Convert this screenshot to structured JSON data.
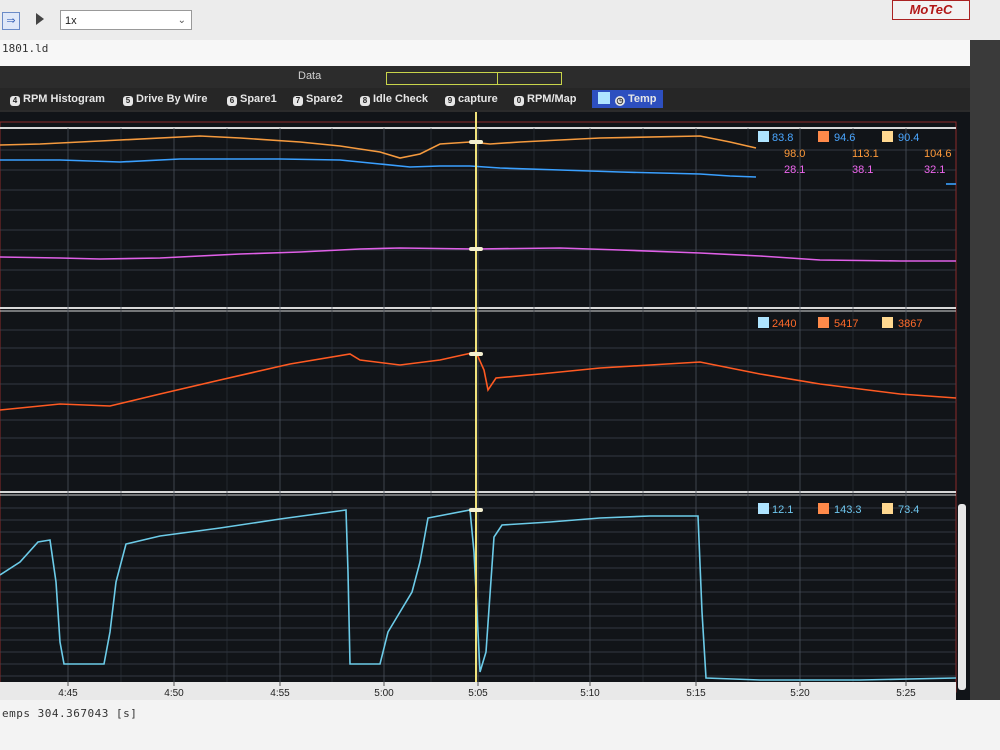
{
  "toolbar": {
    "speed_value": "1x",
    "speed_chevron": "⌄",
    "logo_text": "MoTeC",
    "back_icon": "arrow-icon",
    "play_icon": "play-icon"
  },
  "file": {
    "name": "1801.ld"
  },
  "data_strip": {
    "label": "Data"
  },
  "tabs": [
    {
      "num": "4",
      "label": "RPM Histogram"
    },
    {
      "num": "5",
      "label": "Drive By Wire"
    },
    {
      "num": "6",
      "label": "Spare1"
    },
    {
      "num": "7",
      "label": "Spare2"
    },
    {
      "num": "8",
      "label": "Idle Check"
    },
    {
      "num": "9",
      "label": "capture"
    },
    {
      "num": "0",
      "label": "RPM/Map"
    },
    {
      "num": "",
      "label": "Temp",
      "active": true
    }
  ],
  "panels": [
    {
      "name": "temps",
      "legend_rows": [
        {
          "values": [
            "83.8",
            "94.6",
            "90.4"
          ],
          "color": "#4aa6ff"
        },
        {
          "values": [
            "98.0",
            "113.1",
            "104.6"
          ],
          "color": "#ff9a3a"
        },
        {
          "values": [
            "28.1",
            "38.1",
            "32.1"
          ],
          "color": "#ee66ee"
        }
      ]
    },
    {
      "name": "rpm",
      "legend_rows": [
        {
          "values": [
            "2440",
            "5417",
            "3867"
          ],
          "color": "#ff6a2a"
        }
      ]
    },
    {
      "name": "throttle",
      "legend_rows": [
        {
          "values": [
            "12.1",
            "143.3",
            "73.4"
          ],
          "color": "#6ec6ee"
        }
      ]
    }
  ],
  "legend_icons": [
    "min-icon",
    "max-icon",
    "avg-icon"
  ],
  "x_axis_ticks": [
    "4:45",
    "4:50",
    "4:55",
    "5:00",
    "5:05",
    "5:10",
    "5:15",
    "5:20",
    "5:25"
  ],
  "status": {
    "text": "emps  304.367043 [s]"
  },
  "colors": {
    "blue_trace": "#3aa0ff",
    "orange_trace": "#f59a3e",
    "magenta_trace": "#e060e8",
    "rpm_trace": "#ff5a22",
    "throttle_trace": "#6ccbe8",
    "cursor": "#f0e27a",
    "active_tab": "#2d4fbf"
  }
}
